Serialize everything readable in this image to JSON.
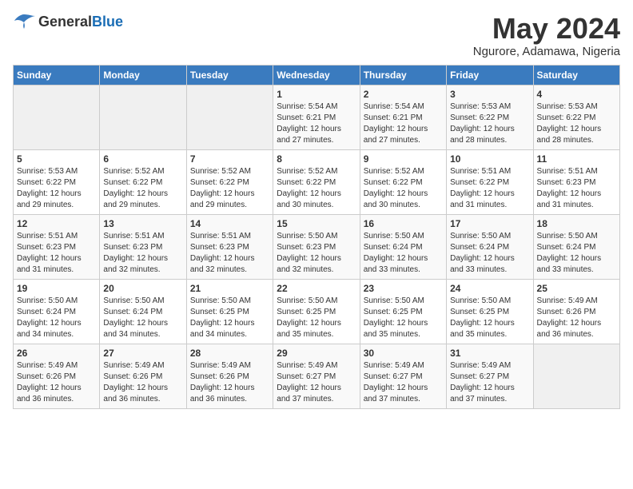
{
  "header": {
    "logo": {
      "general": "General",
      "blue": "Blue"
    },
    "title": "May 2024",
    "location": "Ngurore, Adamawa, Nigeria"
  },
  "days_of_week": [
    "Sunday",
    "Monday",
    "Tuesday",
    "Wednesday",
    "Thursday",
    "Friday",
    "Saturday"
  ],
  "weeks": [
    [
      {
        "day": "",
        "sunrise": "",
        "sunset": "",
        "daylight": "",
        "empty": true
      },
      {
        "day": "",
        "sunrise": "",
        "sunset": "",
        "daylight": "",
        "empty": true
      },
      {
        "day": "",
        "sunrise": "",
        "sunset": "",
        "daylight": "",
        "empty": true
      },
      {
        "day": "1",
        "sunrise": "Sunrise: 5:54 AM",
        "sunset": "Sunset: 6:21 PM",
        "daylight": "Daylight: 12 hours and 27 minutes."
      },
      {
        "day": "2",
        "sunrise": "Sunrise: 5:54 AM",
        "sunset": "Sunset: 6:21 PM",
        "daylight": "Daylight: 12 hours and 27 minutes."
      },
      {
        "day": "3",
        "sunrise": "Sunrise: 5:53 AM",
        "sunset": "Sunset: 6:22 PM",
        "daylight": "Daylight: 12 hours and 28 minutes."
      },
      {
        "day": "4",
        "sunrise": "Sunrise: 5:53 AM",
        "sunset": "Sunset: 6:22 PM",
        "daylight": "Daylight: 12 hours and 28 minutes."
      }
    ],
    [
      {
        "day": "5",
        "sunrise": "Sunrise: 5:53 AM",
        "sunset": "Sunset: 6:22 PM",
        "daylight": "Daylight: 12 hours and 29 minutes."
      },
      {
        "day": "6",
        "sunrise": "Sunrise: 5:52 AM",
        "sunset": "Sunset: 6:22 PM",
        "daylight": "Daylight: 12 hours and 29 minutes."
      },
      {
        "day": "7",
        "sunrise": "Sunrise: 5:52 AM",
        "sunset": "Sunset: 6:22 PM",
        "daylight": "Daylight: 12 hours and 29 minutes."
      },
      {
        "day": "8",
        "sunrise": "Sunrise: 5:52 AM",
        "sunset": "Sunset: 6:22 PM",
        "daylight": "Daylight: 12 hours and 30 minutes."
      },
      {
        "day": "9",
        "sunrise": "Sunrise: 5:52 AM",
        "sunset": "Sunset: 6:22 PM",
        "daylight": "Daylight: 12 hours and 30 minutes."
      },
      {
        "day": "10",
        "sunrise": "Sunrise: 5:51 AM",
        "sunset": "Sunset: 6:22 PM",
        "daylight": "Daylight: 12 hours and 31 minutes."
      },
      {
        "day": "11",
        "sunrise": "Sunrise: 5:51 AM",
        "sunset": "Sunset: 6:23 PM",
        "daylight": "Daylight: 12 hours and 31 minutes."
      }
    ],
    [
      {
        "day": "12",
        "sunrise": "Sunrise: 5:51 AM",
        "sunset": "Sunset: 6:23 PM",
        "daylight": "Daylight: 12 hours and 31 minutes."
      },
      {
        "day": "13",
        "sunrise": "Sunrise: 5:51 AM",
        "sunset": "Sunset: 6:23 PM",
        "daylight": "Daylight: 12 hours and 32 minutes."
      },
      {
        "day": "14",
        "sunrise": "Sunrise: 5:51 AM",
        "sunset": "Sunset: 6:23 PM",
        "daylight": "Daylight: 12 hours and 32 minutes."
      },
      {
        "day": "15",
        "sunrise": "Sunrise: 5:50 AM",
        "sunset": "Sunset: 6:23 PM",
        "daylight": "Daylight: 12 hours and 32 minutes."
      },
      {
        "day": "16",
        "sunrise": "Sunrise: 5:50 AM",
        "sunset": "Sunset: 6:24 PM",
        "daylight": "Daylight: 12 hours and 33 minutes."
      },
      {
        "day": "17",
        "sunrise": "Sunrise: 5:50 AM",
        "sunset": "Sunset: 6:24 PM",
        "daylight": "Daylight: 12 hours and 33 minutes."
      },
      {
        "day": "18",
        "sunrise": "Sunrise: 5:50 AM",
        "sunset": "Sunset: 6:24 PM",
        "daylight": "Daylight: 12 hours and 33 minutes."
      }
    ],
    [
      {
        "day": "19",
        "sunrise": "Sunrise: 5:50 AM",
        "sunset": "Sunset: 6:24 PM",
        "daylight": "Daylight: 12 hours and 34 minutes."
      },
      {
        "day": "20",
        "sunrise": "Sunrise: 5:50 AM",
        "sunset": "Sunset: 6:24 PM",
        "daylight": "Daylight: 12 hours and 34 minutes."
      },
      {
        "day": "21",
        "sunrise": "Sunrise: 5:50 AM",
        "sunset": "Sunset: 6:25 PM",
        "daylight": "Daylight: 12 hours and 34 minutes."
      },
      {
        "day": "22",
        "sunrise": "Sunrise: 5:50 AM",
        "sunset": "Sunset: 6:25 PM",
        "daylight": "Daylight: 12 hours and 35 minutes."
      },
      {
        "day": "23",
        "sunrise": "Sunrise: 5:50 AM",
        "sunset": "Sunset: 6:25 PM",
        "daylight": "Daylight: 12 hours and 35 minutes."
      },
      {
        "day": "24",
        "sunrise": "Sunrise: 5:50 AM",
        "sunset": "Sunset: 6:25 PM",
        "daylight": "Daylight: 12 hours and 35 minutes."
      },
      {
        "day": "25",
        "sunrise": "Sunrise: 5:49 AM",
        "sunset": "Sunset: 6:26 PM",
        "daylight": "Daylight: 12 hours and 36 minutes."
      }
    ],
    [
      {
        "day": "26",
        "sunrise": "Sunrise: 5:49 AM",
        "sunset": "Sunset: 6:26 PM",
        "daylight": "Daylight: 12 hours and 36 minutes."
      },
      {
        "day": "27",
        "sunrise": "Sunrise: 5:49 AM",
        "sunset": "Sunset: 6:26 PM",
        "daylight": "Daylight: 12 hours and 36 minutes."
      },
      {
        "day": "28",
        "sunrise": "Sunrise: 5:49 AM",
        "sunset": "Sunset: 6:26 PM",
        "daylight": "Daylight: 12 hours and 36 minutes."
      },
      {
        "day": "29",
        "sunrise": "Sunrise: 5:49 AM",
        "sunset": "Sunset: 6:27 PM",
        "daylight": "Daylight: 12 hours and 37 minutes."
      },
      {
        "day": "30",
        "sunrise": "Sunrise: 5:49 AM",
        "sunset": "Sunset: 6:27 PM",
        "daylight": "Daylight: 12 hours and 37 minutes."
      },
      {
        "day": "31",
        "sunrise": "Sunrise: 5:49 AM",
        "sunset": "Sunset: 6:27 PM",
        "daylight": "Daylight: 12 hours and 37 minutes."
      },
      {
        "day": "",
        "sunrise": "",
        "sunset": "",
        "daylight": "",
        "empty": true
      }
    ]
  ]
}
